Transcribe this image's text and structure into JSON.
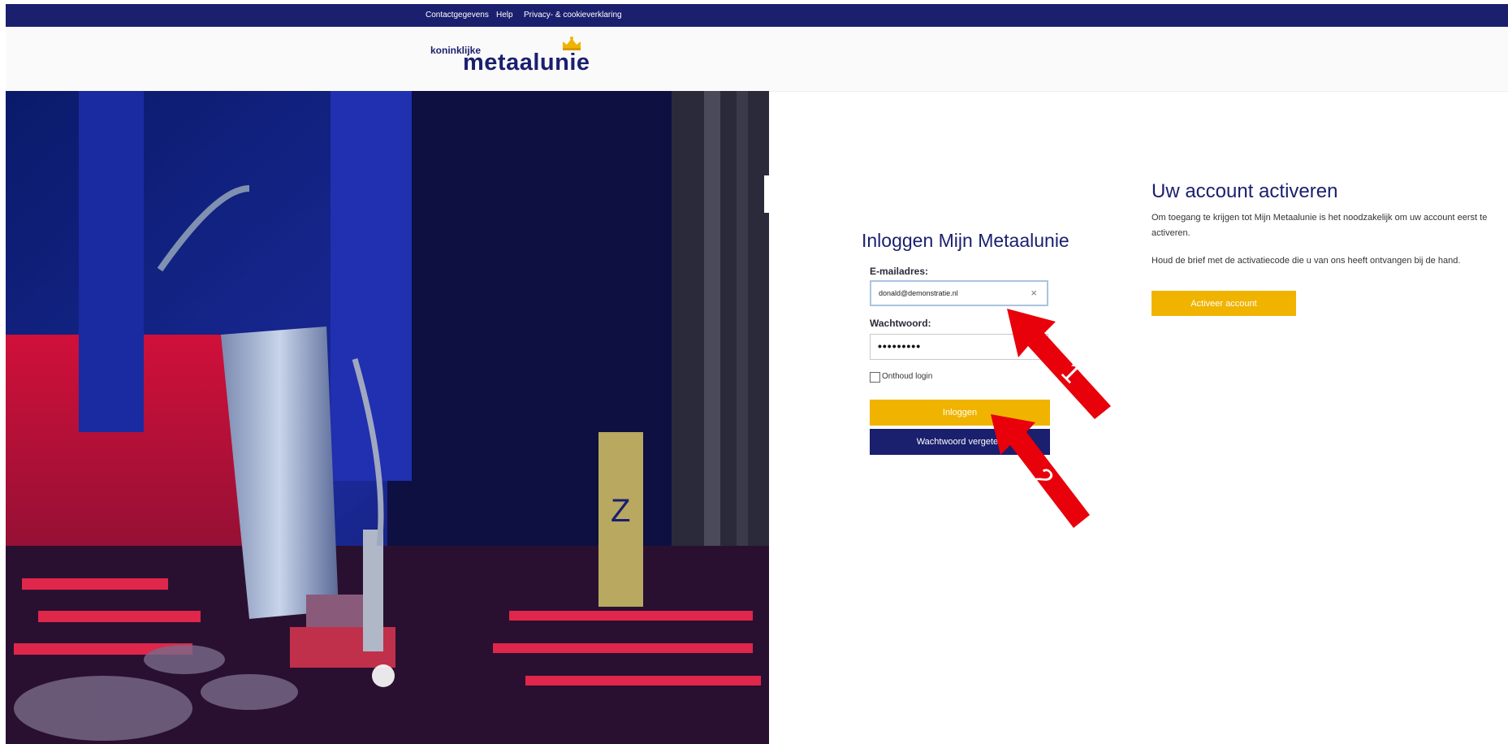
{
  "topbar": {
    "links": [
      "Contactgegevens",
      "Help",
      "Privacy- & cookieverklaring"
    ]
  },
  "logo": {
    "small": "koninklijke",
    "big": "metaalunie"
  },
  "login": {
    "title": "Inloggen Mijn Metaalunie",
    "email_label": "E-mailadres:",
    "email_value": "donald@demonstratie.nl",
    "password_label": "Wachtwoord:",
    "password_value": "•••••••••",
    "remember_label": "Onthoud login",
    "login_button": "Inloggen",
    "forgot_button": "Wachtwoord vergeten"
  },
  "activation": {
    "title": "Uw account activeren",
    "text": "Om toegang te krijgen tot Mijn Metaalunie is het noodzakelijk om uw account eerst te activeren.",
    "text2": "Houd de brief met de activatiecode die u van ons heeft ontvangen bij de hand.",
    "button": "Activeer account"
  },
  "annotations": {
    "arrow1": "1",
    "arrow2": "2"
  },
  "colors": {
    "navy": "#1a1f6e",
    "yellow": "#f0b400",
    "arrow_red": "#e8000a"
  },
  "hero_image": "laser-cutting-machine-photo"
}
